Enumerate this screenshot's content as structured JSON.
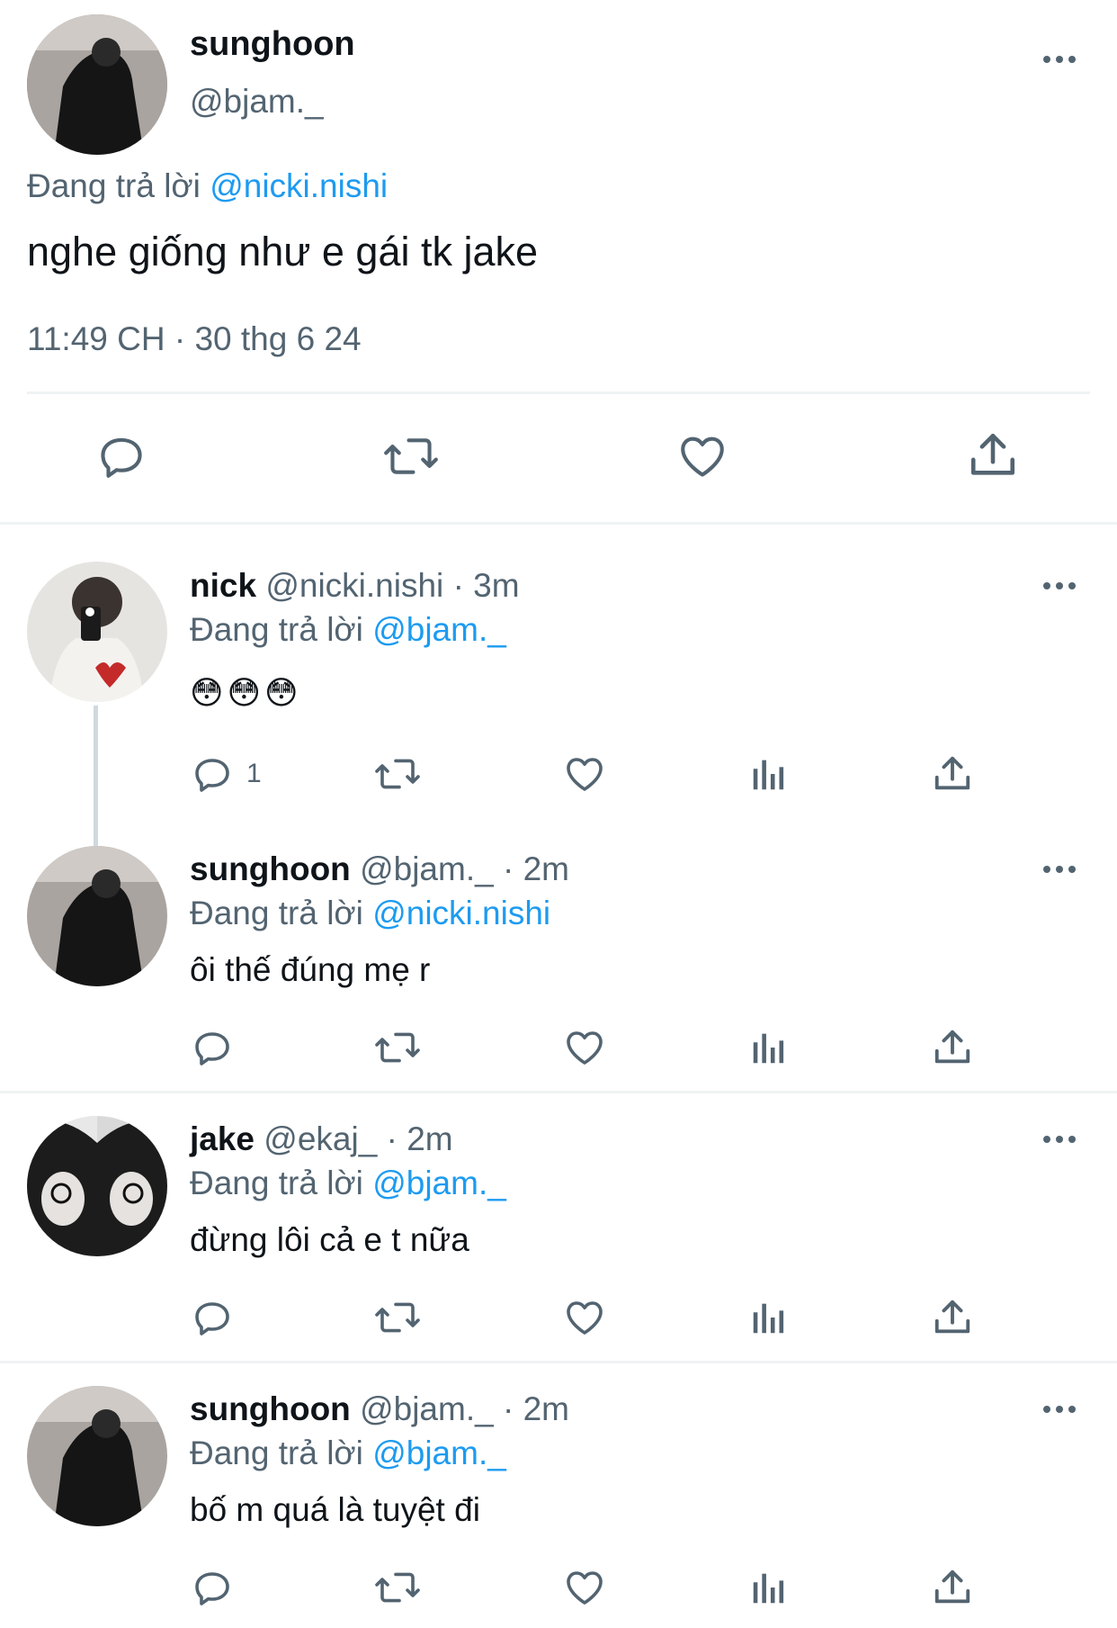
{
  "colors": {
    "link": "#1d9bf0",
    "muted": "#536471",
    "divider": "#eff3f4"
  },
  "main_tweet": {
    "name": "sunghoon",
    "handle": "@bjam._",
    "reply_prefix": "Đang trả lời",
    "reply_to": "@nicki.nishi",
    "text": "nghe giống như e gái tk jake",
    "timestamp": "11:49 CH · 30 thg 6 24"
  },
  "replies": [
    {
      "name": "nick",
      "handle": "@nicki.nishi",
      "time": "· 3m",
      "reply_prefix": "Đang trả lời",
      "reply_to": "@bjam._",
      "text": "😳😳😳",
      "reply_count": "1"
    },
    {
      "name": "sunghoon",
      "handle": "@bjam._",
      "time": "· 2m",
      "reply_prefix": "Đang trả lời",
      "reply_to": "@nicki.nishi",
      "text": "ôi thế đúng mẹ r",
      "reply_count": ""
    },
    {
      "name": "jake",
      "handle": "@ekaj_",
      "time": "· 2m",
      "reply_prefix": "Đang trả lời",
      "reply_to": "@bjam._",
      "text": "đừng lôi cả e t nữa",
      "reply_count": ""
    },
    {
      "name": "sunghoon",
      "handle": "@bjam._",
      "time": "· 2m",
      "reply_prefix": "Đang trả lời",
      "reply_to": "@bjam._",
      "text": "bố m quá là tuyệt đi",
      "reply_count": ""
    }
  ]
}
